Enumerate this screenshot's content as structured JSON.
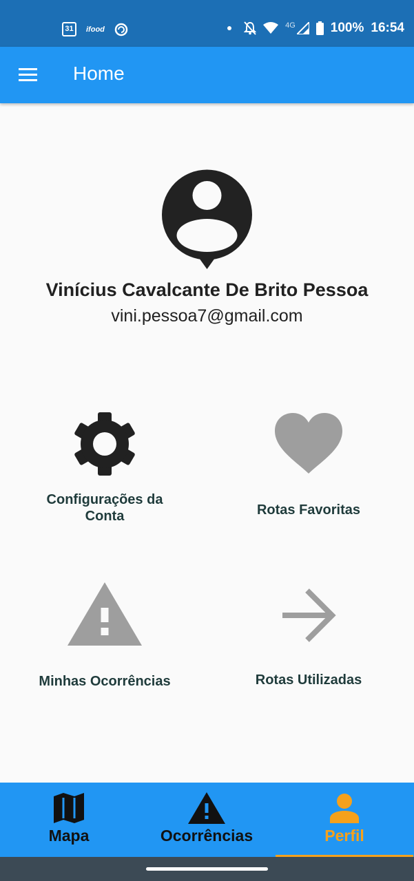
{
  "status_bar": {
    "calendar_day": "31",
    "ifood": "ifood",
    "network": "4G",
    "battery": "100%",
    "time": "16:54",
    "icons": [
      "calendar-icon",
      "ifood-icon",
      "sync-icon",
      "notifications-off-icon",
      "wifi-icon",
      "signal-icon",
      "battery-icon"
    ]
  },
  "app_bar": {
    "title": "Home",
    "menu_icon": "menu-icon"
  },
  "profile": {
    "name": "Vinícius Cavalcante De Brito Pessoa",
    "email": "vini.pessoa7@gmail.com",
    "avatar_icon": "person-pin-icon"
  },
  "options": [
    {
      "label": "Configurações da Conta",
      "icon": "gear-icon",
      "icon_color": "#212121"
    },
    {
      "label": "Rotas Favoritas",
      "icon": "heart-icon",
      "icon_color": "#9e9e9e"
    },
    {
      "label": "Minhas Ocorrências",
      "icon": "warning-icon",
      "icon_color": "#9e9e9e"
    },
    {
      "label": "Rotas Utilizadas",
      "icon": "arrow-right-icon",
      "icon_color": "#9e9e9e"
    }
  ],
  "bottom_nav": {
    "items": [
      {
        "label": "Mapa",
        "icon": "map-icon"
      },
      {
        "label": "Ocorrências",
        "icon": "warning-icon"
      },
      {
        "label": "Perfil",
        "icon": "person-icon"
      }
    ],
    "active_index": 2
  },
  "colors": {
    "status_bar": "#1c6fb5",
    "primary": "#2196f3",
    "accent": "#f5a11c",
    "background": "#fafafa",
    "text": "#212121"
  }
}
